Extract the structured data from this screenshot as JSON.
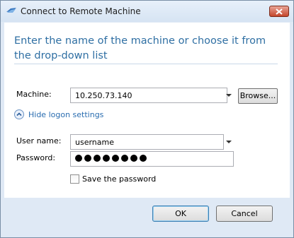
{
  "window": {
    "title": "Connect to Remote Machine",
    "app_icon": "remote-desktop-icon",
    "close_icon": "close-icon"
  },
  "heading": "Enter the name of the machine or choose it from the drop-down list",
  "machine": {
    "label": "Machine:",
    "value": "10.250.73.140",
    "browse_label": "Browse..."
  },
  "logon": {
    "toggle_label": "Hide logon settings",
    "username_label": "User name:",
    "username_value": "username",
    "password_label": "Password:",
    "password_mask_count": 8,
    "save_password_label": "Save the password",
    "save_password_checked": false
  },
  "buttons": {
    "ok": "OK",
    "cancel": "Cancel"
  },
  "colors": {
    "heading": "#2f6fa3",
    "link": "#2a6db0",
    "frame": "#dfe9f5",
    "close": "#c4462b"
  }
}
